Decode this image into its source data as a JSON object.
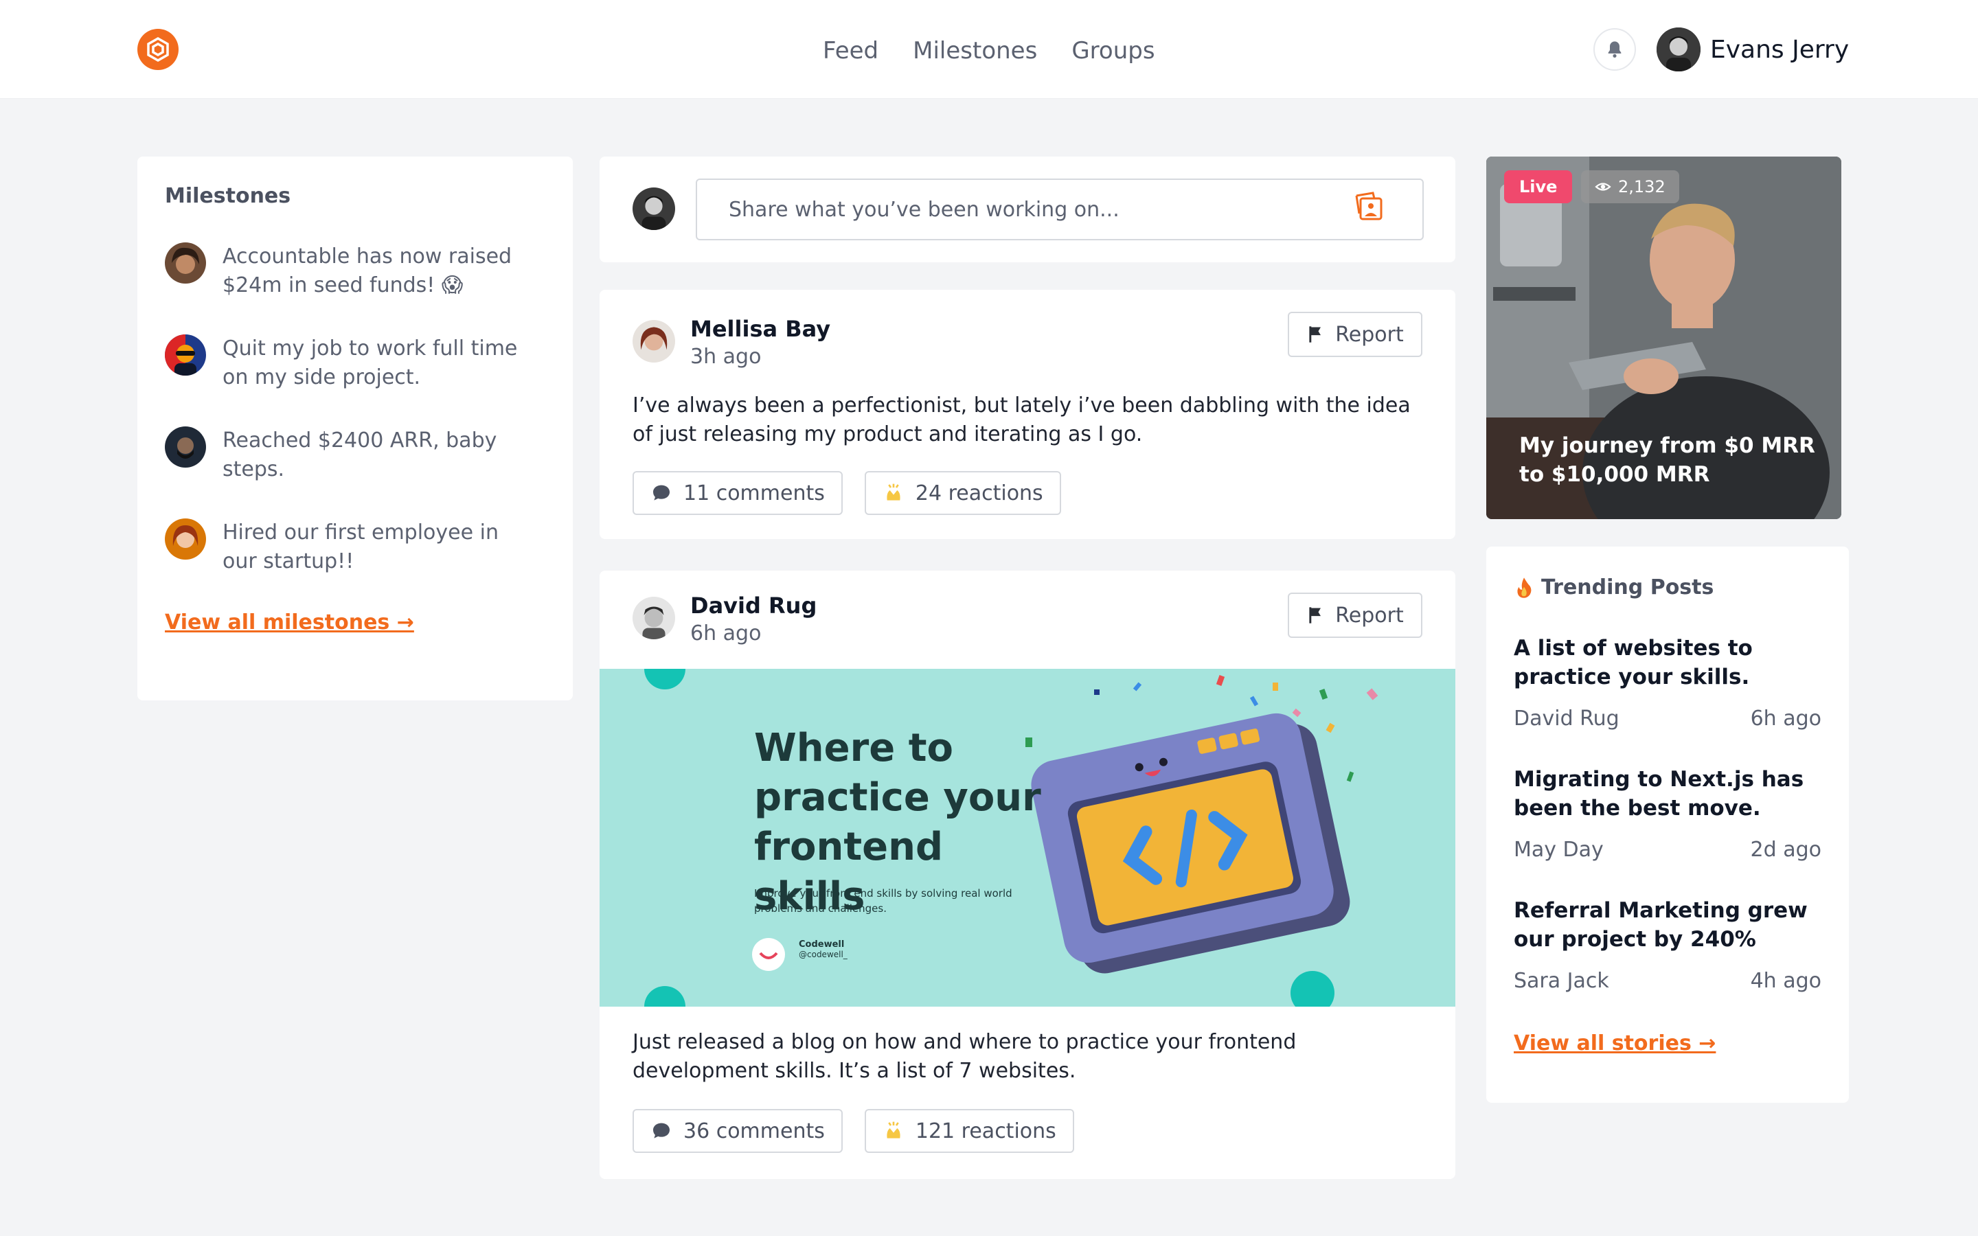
{
  "header": {
    "nav": [
      "Feed",
      "Milestones",
      "Groups"
    ],
    "user_name": "Evans Jerry"
  },
  "milestones": {
    "title": "Milestones",
    "items": [
      {
        "text": "Accountable has now raised $24m in seed funds! 😱"
      },
      {
        "text": "Quit my job to work full time on my side project."
      },
      {
        "text": "Reached $2400 ARR, baby steps."
      },
      {
        "text": "Hired our first employee in our startup!!"
      }
    ],
    "view_all": "View all milestones →"
  },
  "composer": {
    "placeholder": "Share what you’ve been working on..."
  },
  "posts": [
    {
      "author": "Mellisa Bay",
      "time": "3h ago",
      "report_label": "Report",
      "body": "I’ve always been a perfectionist, but lately i’ve been dabbling with the idea of just releasing my product and iterating as I go.",
      "comments": "11 comments",
      "reactions": "24 reactions"
    },
    {
      "author": "David Rug",
      "time": "6h ago",
      "report_label": "Report",
      "banner": {
        "title": "Where to practice your frontend skills",
        "subtitle": "Improve your front end skills by solving real world problems and challenges.",
        "brand": "Codewell",
        "handle": "@codewell_"
      },
      "body": "Just released a blog on how and where to practice your frontend development skills. It’s a list of 7 websites.",
      "comments": "36 comments",
      "reactions": "121 reactions"
    }
  ],
  "live": {
    "badge": "Live",
    "views": "2,132",
    "title": "My journey from $0 MRR to $10,000 MRR"
  },
  "trending": {
    "title": "Trending Posts",
    "items": [
      {
        "title": "A list of websites to practice your skills.",
        "author": "David Rug",
        "time": "6h ago"
      },
      {
        "title": "Migrating to Next.js has been the best move.",
        "author": "May Day",
        "time": "2d ago"
      },
      {
        "title": "Referral Marketing grew our project by 240%",
        "author": "Sara Jack",
        "time": "4h ago"
      }
    ],
    "view_all": "View all stories →"
  },
  "colors": {
    "accent": "#f26b1d",
    "live": "#f0496d",
    "banner": "#a6e4dd",
    "background": "#f3f4f6"
  }
}
